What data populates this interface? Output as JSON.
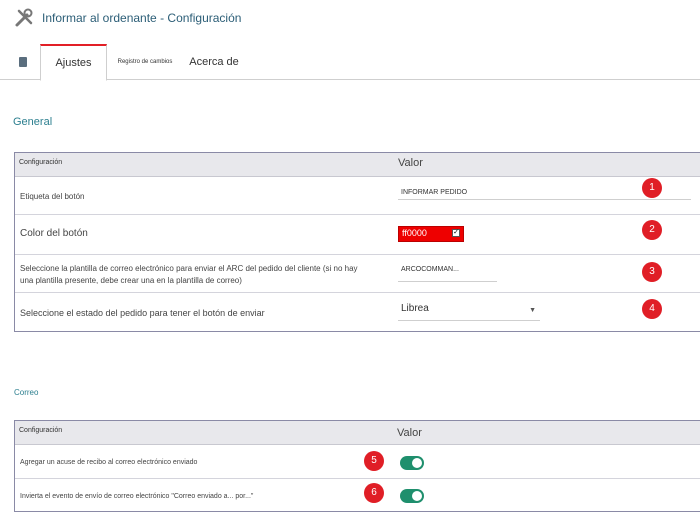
{
  "header": {
    "title": "Informar al ordenante - Configuración",
    "icon": "tools-icon"
  },
  "tabs": [
    {
      "label": "Ajustes",
      "active": true
    },
    {
      "label": "Registro de cambios",
      "active": false
    },
    {
      "label": "Acerca de",
      "active": false
    }
  ],
  "general": {
    "title": "General",
    "header_config": "Configuración",
    "header_valor": "Valor",
    "rows": [
      {
        "label": "Etiqueta del botón",
        "value": "INFORMAR PEDIDO"
      },
      {
        "label": "Color del botón",
        "value": "ff0000"
      },
      {
        "label": "Seleccione la plantilla de correo electrónico para enviar el ARC del pedido del cliente (si no hay una plantilla presente, debe crear una en la plantilla de correo)",
        "value": "ARCOCOMMAN..."
      },
      {
        "label": "Seleccione el estado del pedido para tener el botón de enviar",
        "value": "Librea"
      }
    ]
  },
  "correo": {
    "title": "Correo",
    "header_config": "Configuración",
    "header_valor": "Valor",
    "rows": [
      {
        "label": "Agregar un acuse de recibo al correo electrónico enviado",
        "enabled": true
      },
      {
        "label": "Invierta el evento de envío de correo electrónico \"Correo enviado a... por...\"",
        "enabled": true
      }
    ]
  },
  "badges": [
    "1",
    "2",
    "3",
    "4",
    "5",
    "6"
  ],
  "colors": {
    "accent": "#e21f26",
    "toggle_on": "#1f8f6d",
    "section_title": "#2c7f8f",
    "color_swatch": "#ee0000"
  }
}
